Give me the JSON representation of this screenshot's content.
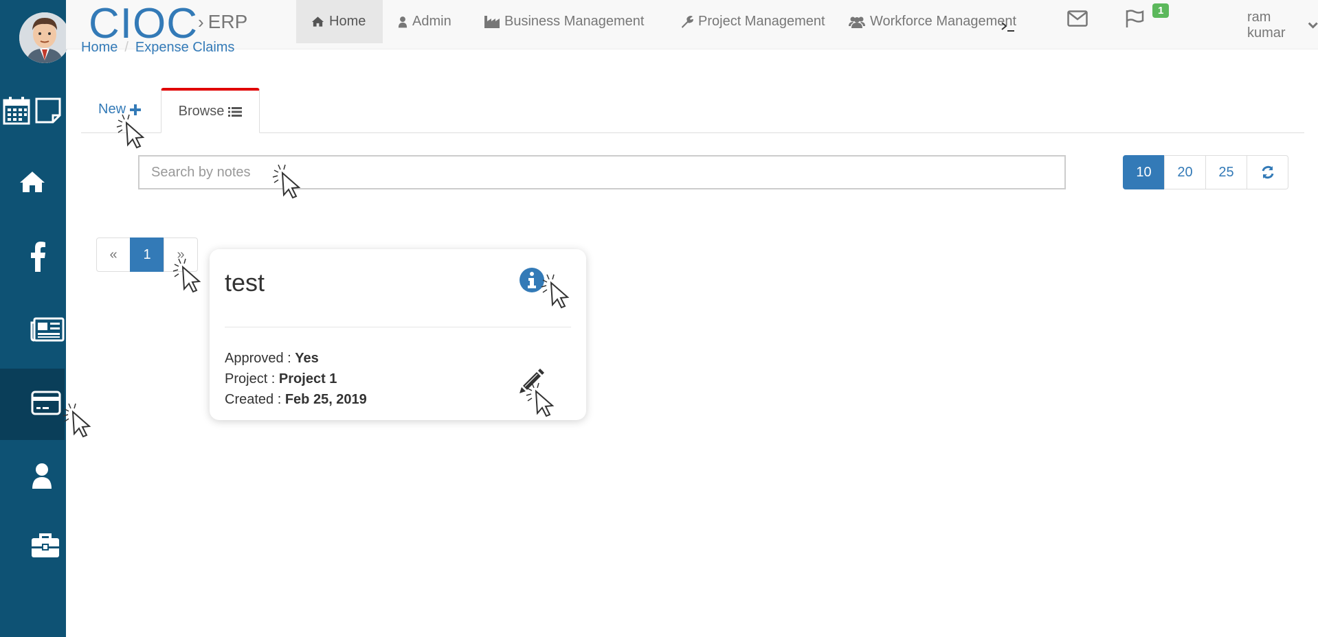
{
  "brand": {
    "title": "CIOC",
    "subtitle": "ERP"
  },
  "nav": {
    "items": [
      {
        "label": "Home",
        "icon": "home-icon"
      },
      {
        "label": "Admin",
        "icon": "user-icon"
      },
      {
        "label": "Business Management",
        "icon": "industry-icon"
      },
      {
        "label": "Project Management",
        "icon": "wrench-icon"
      },
      {
        "label": "Workforce Management",
        "icon": "users-icon"
      }
    ],
    "mail_badge": "1",
    "user_name": "ram kumar"
  },
  "breadcrumb": {
    "home": "Home",
    "current": "Expense Claims"
  },
  "tabs": {
    "new_label": "New",
    "browse_label": "Browse"
  },
  "search": {
    "placeholder": "Search by notes",
    "value": ""
  },
  "page_sizes": [
    "10",
    "20",
    "25"
  ],
  "pagination": {
    "prev": "«",
    "current": "1",
    "next": "»"
  },
  "card": {
    "title": "test",
    "approved_label": "Approved : ",
    "approved_value": "Yes",
    "project_label": "Project : ",
    "project_value": "Project 1",
    "created_label": "Created : ",
    "created_value": "Feb 25, 2019"
  },
  "colors": {
    "sidebar": "#0e5274",
    "sidebar_active": "#0a3e59",
    "brand": "#337ab7",
    "active_tab_border": "#e00000",
    "badge": "#5cb85c"
  }
}
